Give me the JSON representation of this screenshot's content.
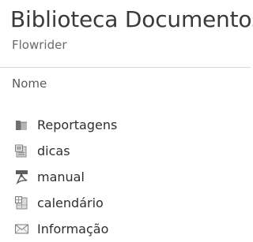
{
  "header": {
    "title": "Biblioteca Documentos",
    "subtitle": "Flowrider"
  },
  "list": {
    "column_header": "Nome",
    "items": [
      {
        "label": "Reportagens",
        "icon": "folder-icon"
      },
      {
        "label": "dicas",
        "icon": "document-icon"
      },
      {
        "label": "manual",
        "icon": "pdf-icon"
      },
      {
        "label": "calendário",
        "icon": "spreadsheet-icon"
      },
      {
        "label": "Informação",
        "icon": "email-icon"
      }
    ]
  }
}
